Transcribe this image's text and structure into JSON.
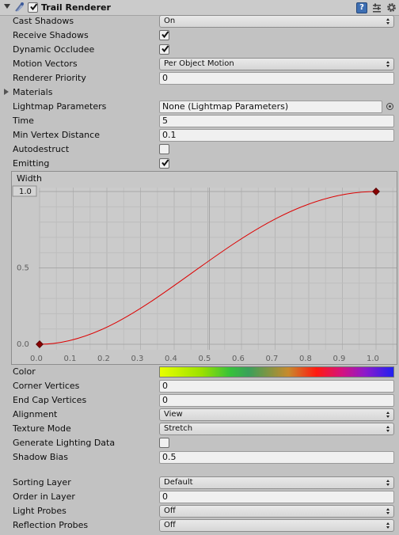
{
  "header": {
    "title": "Trail Renderer",
    "enabled": true,
    "icons": [
      "trail-renderer-icon",
      "help-icon",
      "preset-icon",
      "gear-icon"
    ]
  },
  "properties": [
    {
      "key": "cast_shadows",
      "label": "Cast Shadows",
      "type": "dropdown",
      "value": "On"
    },
    {
      "key": "receive_shadows",
      "label": "Receive Shadows",
      "type": "checkbox",
      "checked": true
    },
    {
      "key": "dynamic_occludee",
      "label": "Dynamic Occludee",
      "type": "checkbox",
      "checked": true
    },
    {
      "key": "motion_vectors",
      "label": "Motion Vectors",
      "type": "dropdown",
      "value": "Per Object Motion"
    },
    {
      "key": "renderer_priority",
      "label": "Renderer Priority",
      "type": "field",
      "value": "0"
    },
    {
      "key": "materials",
      "label": "Materials",
      "type": "foldout"
    },
    {
      "key": "lightmap_parameters",
      "label": "Lightmap Parameters",
      "type": "object",
      "value": "None (Lightmap Parameters)"
    },
    {
      "key": "time",
      "label": "Time",
      "type": "field",
      "value": "5"
    },
    {
      "key": "min_vertex_distance",
      "label": "Min Vertex Distance",
      "type": "field",
      "value": "0.1"
    },
    {
      "key": "autodestruct",
      "label": "Autodestruct",
      "type": "checkbox",
      "checked": false
    },
    {
      "key": "emitting",
      "label": "Emitting",
      "type": "checkbox",
      "checked": true
    }
  ],
  "width_curve": {
    "title": "Width",
    "max_label": "1.0",
    "y_labels": [
      "0.5",
      "0.0"
    ],
    "x_labels": [
      "0.0",
      "0.1",
      "0.2",
      "0.3",
      "0.4",
      "0.5",
      "0.6",
      "0.7",
      "0.8",
      "0.9",
      "1.0"
    ]
  },
  "chart_data": {
    "type": "line",
    "title": "Width",
    "xlabel": "",
    "ylabel": "",
    "xlim": [
      0.0,
      1.05
    ],
    "ylim": [
      0.0,
      1.0
    ],
    "grid": true,
    "series": [
      {
        "name": "Width",
        "color": "#dd0000",
        "keys": [
          {
            "x": 0.0,
            "y": 0.0
          },
          {
            "x": 1.0,
            "y": 1.0
          }
        ],
        "x": [
          0.0,
          0.1,
          0.2,
          0.3,
          0.4,
          0.5,
          0.6,
          0.7,
          0.8,
          0.9,
          1.0
        ],
        "y": [
          0.0,
          0.03,
          0.1,
          0.2,
          0.33,
          0.49,
          0.63,
          0.77,
          0.89,
          0.97,
          1.0
        ]
      }
    ],
    "x_ticks": [
      "0.0",
      "0.1",
      "0.2",
      "0.3",
      "0.4",
      "0.5",
      "0.6",
      "0.7",
      "0.8",
      "0.9",
      "1.0"
    ],
    "y_ticks": [
      "0.0",
      "0.5",
      "1.0"
    ]
  },
  "properties2": [
    {
      "key": "color",
      "label": "Color",
      "type": "gradient"
    },
    {
      "key": "corner_vertices",
      "label": "Corner Vertices",
      "type": "field",
      "value": "0"
    },
    {
      "key": "end_cap_vertices",
      "label": "End Cap Vertices",
      "type": "field",
      "value": "0"
    },
    {
      "key": "alignment",
      "label": "Alignment",
      "type": "dropdown",
      "value": "View"
    },
    {
      "key": "texture_mode",
      "label": "Texture Mode",
      "type": "dropdown",
      "value": "Stretch"
    },
    {
      "key": "generate_lighting_data",
      "label": "Generate Lighting Data",
      "type": "checkbox",
      "checked": false
    },
    {
      "key": "shadow_bias",
      "label": "Shadow Bias",
      "type": "field",
      "value": "0.5"
    }
  ],
  "properties3": [
    {
      "key": "sorting_layer",
      "label": "Sorting Layer",
      "type": "dropdown",
      "value": "Default"
    },
    {
      "key": "order_in_layer",
      "label": "Order in Layer",
      "type": "field",
      "value": "0"
    },
    {
      "key": "light_probes",
      "label": "Light Probes",
      "type": "dropdown",
      "value": "Off"
    },
    {
      "key": "reflection_probes",
      "label": "Reflection Probes",
      "type": "dropdown",
      "value": "Off"
    }
  ]
}
